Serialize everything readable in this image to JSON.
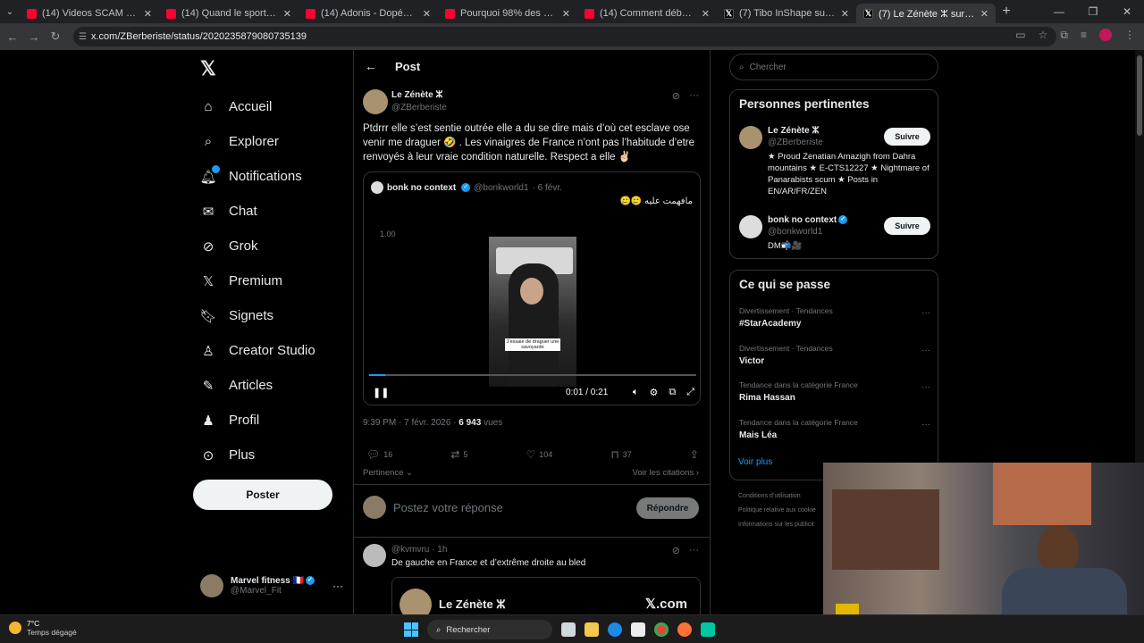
{
  "browser": {
    "tabs": [
      {
        "title": "(14) Videos SCAM & PICKPOCK",
        "icon": "youtube",
        "active": false
      },
      {
        "title": "(14) Quand le sport devient TO",
        "icon": "youtube",
        "active": false
      },
      {
        "title": "(14) Adonis - Dopés à la muscu",
        "icon": "youtube",
        "active": false
      },
      {
        "title": "Pourquoi 98% des étrangers n",
        "icon": "youtube",
        "active": false
      },
      {
        "title": "(14) Comment débuter le Strea",
        "icon": "youtube",
        "active": false
      },
      {
        "title": "(7) Tibo InShape sur X : \"Il trav",
        "icon": "x",
        "active": false
      },
      {
        "title": "(7) Le Zénète ⵣ sur X : \"Ptd",
        "icon": "x",
        "active": true
      }
    ],
    "url": "x.com/ZBerberiste/status/2020235879080735139"
  },
  "sidebar": {
    "logo": "𝕏",
    "items": [
      {
        "label": "Accueil",
        "icon": "⌂",
        "name": "home"
      },
      {
        "label": "Explorer",
        "icon": "⌕",
        "name": "explore"
      },
      {
        "label": "Notifications",
        "icon": "🔔︎",
        "name": "notifications"
      },
      {
        "label": "Chat",
        "icon": "✉",
        "name": "chat"
      },
      {
        "label": "Grok",
        "icon": "⊘",
        "name": "grok"
      },
      {
        "label": "Premium",
        "icon": "𝕏",
        "name": "premium"
      },
      {
        "label": "Signets",
        "icon": "🔖︎",
        "name": "bookmarks"
      },
      {
        "label": "Creator Studio",
        "icon": "♙",
        "name": "creator-studio"
      },
      {
        "label": "Articles",
        "icon": "✎",
        "name": "articles"
      },
      {
        "label": "Profil",
        "icon": "♟",
        "name": "profile"
      },
      {
        "label": "Plus",
        "icon": "⊙",
        "name": "more"
      }
    ],
    "post_button": "Poster",
    "account": {
      "name": "Marvel fitness 🇫🇷",
      "handle": "@Marvel_Fit"
    }
  },
  "header": {
    "title": "Post"
  },
  "tweet": {
    "name": "Le Zénète ⵣ",
    "handle": "@ZBerberiste",
    "text": "Ptdrrr elle s’est sentie outrée elle a du se dire mais d’où cet esclave ose venir me draguer 🤣 . Les vinaigres de France n’ont pas l’habitude d’etre renvoyés à leur vraie condition naturelle. Respect a elle ✌🏻",
    "date": "9:39 PM · 7 févr. 2026 · ",
    "views": "6 943",
    "views_label": " vues",
    "counts": {
      "replies": "16",
      "reposts": "5",
      "likes": "104",
      "bookmarks": "37"
    }
  },
  "quote": {
    "name": "bonk no context",
    "handle": "@bonkworld1",
    "date": "· 6 févr.",
    "text": "مافهمت عليه 🥲🥲",
    "video": {
      "speed": "1.00",
      "caption": "J’essaie de draguer une savoyarde",
      "time": "0:01 / 0:21",
      "progress": 0.05
    }
  },
  "replies": {
    "sort_label": "Pertinence",
    "quotes_link": "Voir les citations ›",
    "placeholder": "Postez votre réponse",
    "reply_button": "Répondre",
    "item": {
      "handle": "@kvmvru · 1h",
      "text": "De gauche en France et d’extrême droite au bled",
      "embed_name": "Le Zénète ⵣ",
      "embed_logo": "𝕏.com"
    }
  },
  "right": {
    "search_placeholder": "Chercher",
    "people_title": "Personnes pertinentes",
    "people": [
      {
        "name": "Le Zénète ⵣ",
        "handle": "@ZBerberiste",
        "bio": "★ Proud Zenatian Amazigh from Dahra mountains ★ E-CTS12227 ★ Nightmare of Panarabists scum ★ Posts in EN/AR/FR/ZEN",
        "follow": "Suivre"
      },
      {
        "name": "bonk no context",
        "handle": "@bonkworld1",
        "bio": "DM📬🎥",
        "follow": "Suivre"
      }
    ],
    "trends_title": "Ce qui se passe",
    "trends": [
      {
        "context": "Divertissement · Tendances",
        "name": "#StarAcademy"
      },
      {
        "context": "Divertissement · Tendances",
        "name": "Victor"
      },
      {
        "context": "Tendance dans la catégorie France",
        "name": "Rima Hassan"
      },
      {
        "context": "Tendance dans la catégorie France",
        "name": "Mais Léa"
      }
    ],
    "see_more": "Voir plus",
    "footer": [
      "Conditions d’utilisation",
      "Politique relative aux cookie",
      "Informations sur les publicit"
    ]
  },
  "taskbar": {
    "temp": "7°C",
    "condition": "Temps dégagé",
    "search": "Rechercher"
  }
}
